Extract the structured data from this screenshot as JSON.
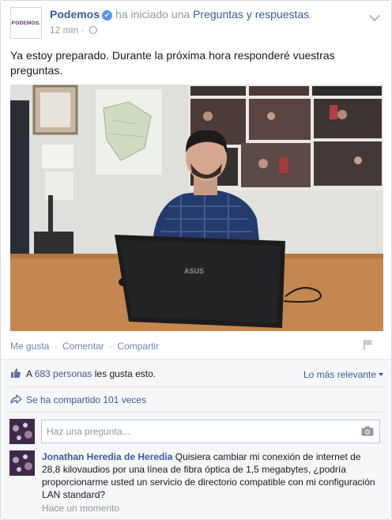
{
  "post": {
    "avatar_text": "PODEMOS.",
    "page_name": "Podemos",
    "verified_mark": "✔",
    "action_text": "ha iniciado una",
    "action_link": "Preguntas y respuestas",
    "action_end": ".",
    "timestamp": "12 min",
    "meta_sep": " · ",
    "text": "Ya estoy preparado. Durante la próxima hora responderé vuestras preguntas.",
    "photo_laptop_brand": "ASUS"
  },
  "actions": {
    "like": "Me gusta",
    "comment": "Comentar",
    "share": "Compartir",
    "sep": "·"
  },
  "social": {
    "likes_prefix": "A",
    "likes_count": "683 personas",
    "likes_suffix": "les gusta esto.",
    "sort_label": "Lo más relevante",
    "shares_text": "Se ha compartido 101 veces"
  },
  "ask": {
    "placeholder": "Haz una pregunta..."
  },
  "comment": {
    "author": "Jonathan Heredia de Heredia",
    "text": "Quisiera cambiar mi conexión de internet de 28,8 kilovaudios por una línea de fibra óptica de 1,5 megabytes, ¿podría proporcionarme usted un servicio de directorio compatible con mi configuración LAN standard?",
    "time": "Hace un momento"
  },
  "colors": {
    "link": "#3b5998",
    "meta": "#9197a3",
    "verified": "#5890ff",
    "brand": "#5a2b67"
  }
}
